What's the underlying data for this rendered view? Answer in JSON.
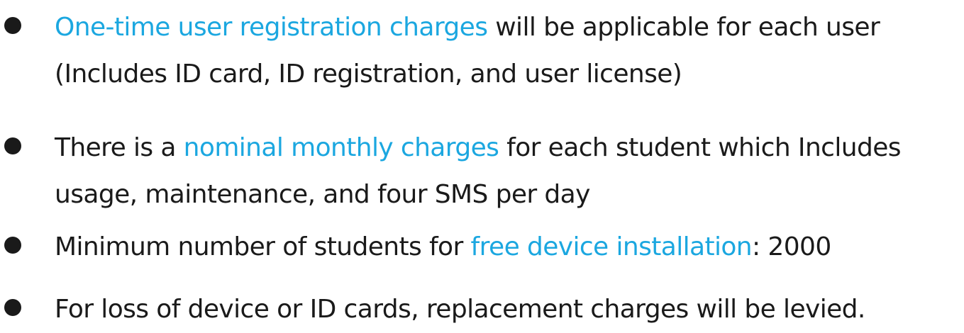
{
  "colors": {
    "text": "#1a1a1a",
    "highlight": "#1ba7e0",
    "background": "#ffffff"
  },
  "items": [
    {
      "highlight": "One-time user registration charges",
      "after": " will be applicable for each user",
      "line2": "(Includes ID card, ID registration, and user license)"
    },
    {
      "before": "There is a ",
      "highlight": "nominal monthly charges",
      "after": " for each student which Includes",
      "line2": "usage, maintenance, and four SMS per day"
    },
    {
      "before": "Minimum number of students for ",
      "highlight": "free device installation",
      "after": ": 2000"
    },
    {
      "text": "For loss of device or ID cards, replacement charges will be levied."
    }
  ]
}
